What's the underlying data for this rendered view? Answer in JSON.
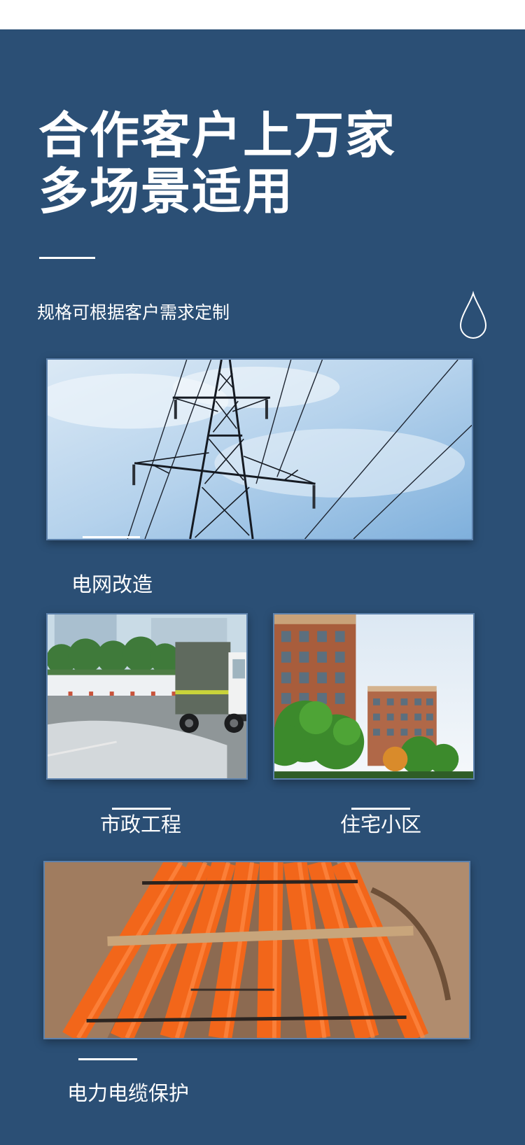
{
  "headline": {
    "line1": "合作客户上万家",
    "line2": "多场景适用"
  },
  "subtitle": "规格可根据客户需求定制",
  "icons": {
    "drop": "water-drop-icon"
  },
  "scenes": [
    {
      "label": "电网改造"
    },
    {
      "label": "市政工程"
    },
    {
      "label": "住宅小区"
    },
    {
      "label": "电力电缆保护"
    }
  ],
  "colors": {
    "panel_background": "#2b4f75",
    "text": "#ffffff",
    "pipe_orange": "#f06a1e"
  }
}
